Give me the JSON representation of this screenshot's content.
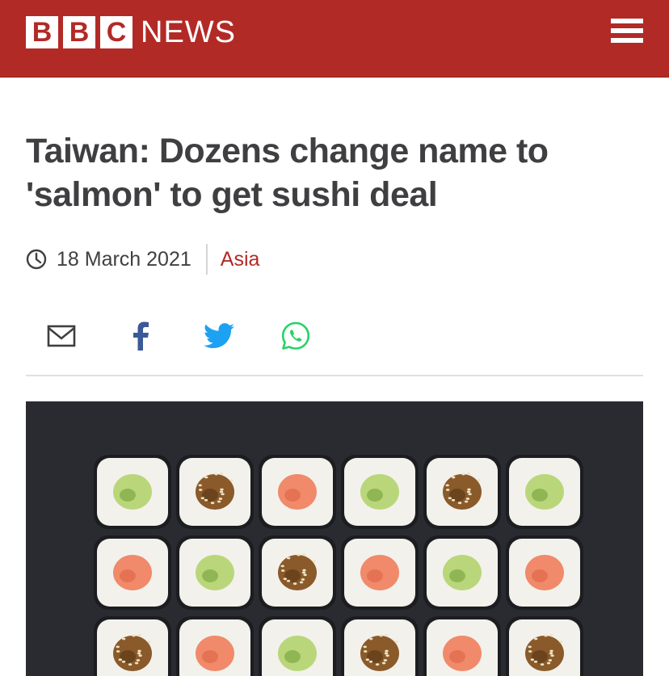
{
  "header": {
    "logo_letters": [
      "B",
      "B",
      "C"
    ],
    "news_label": "NEWS",
    "menu_icon": "hamburger-menu-icon",
    "brand_color": "#b22a26"
  },
  "article": {
    "headline": "Taiwan: Dozens change name to 'salmon' to get sushi deal",
    "date": "18 March 2021",
    "section": "Asia",
    "section_color": "#b22a26"
  },
  "share": {
    "icons": [
      "email-icon",
      "facebook-icon",
      "twitter-icon",
      "whatsapp-icon"
    ],
    "colors": {
      "email": "#3f3f42",
      "facebook": "#3b5998",
      "twitter": "#1da1f2",
      "whatsapp": "#25d366"
    }
  },
  "image": {
    "icon": "sushi-rolls-photo",
    "background_color": "#2a2b30"
  }
}
